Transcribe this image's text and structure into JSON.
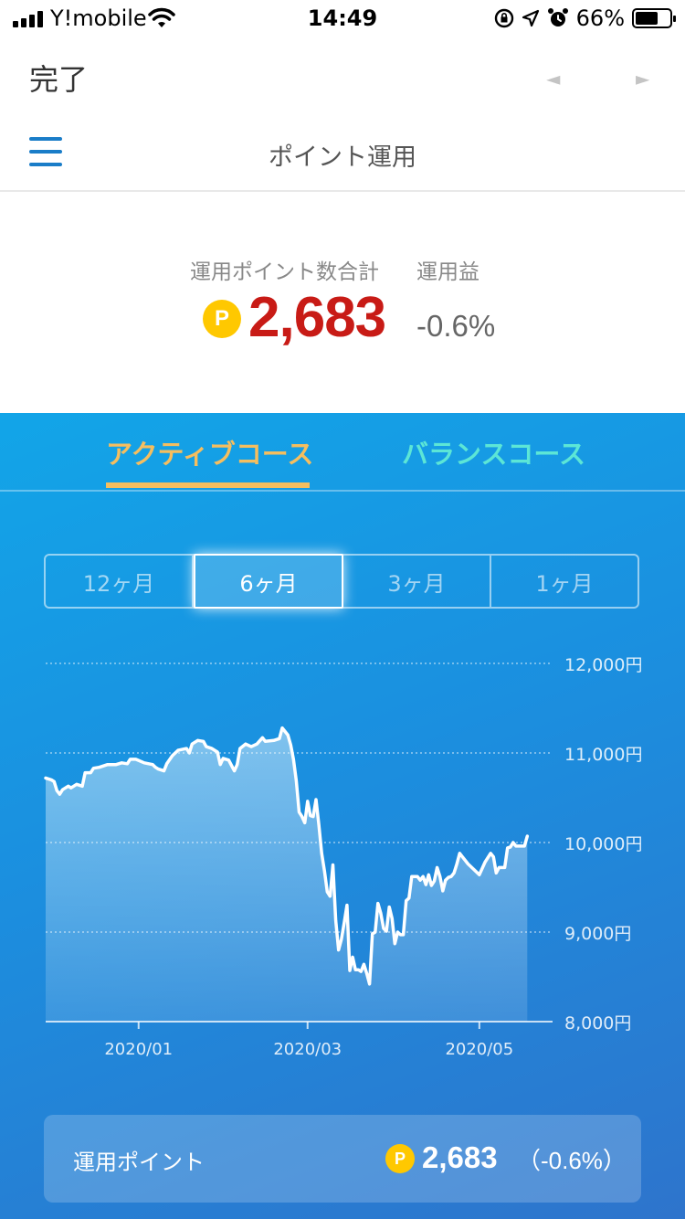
{
  "status_bar": {
    "carrier": "Y!mobile",
    "time": "14:49",
    "battery": "66%",
    "battery_level": 0.66
  },
  "nav": {
    "done_label": "完了",
    "prev_glyph": "◄",
    "next_glyph": "►",
    "title": "ポイント運用"
  },
  "summary": {
    "total_label": "運用ポイント数合計",
    "gain_label": "運用益",
    "coin_letter": "P",
    "total_value": "2,683",
    "gain_value": "-0.6%"
  },
  "tabs": [
    {
      "label": "アクティブコース",
      "active": true
    },
    {
      "label": "バランスコース",
      "active": false
    }
  ],
  "periods": [
    {
      "label": "12ヶ月",
      "active": false
    },
    {
      "label": "6ヶ月",
      "active": true
    },
    {
      "label": "3ヶ月",
      "active": false
    },
    {
      "label": "1ヶ月",
      "active": false
    }
  ],
  "chart_data": {
    "type": "area",
    "y_ticks": [
      "12,000円",
      "11,000円",
      "10,000円",
      "9,000円",
      "8,000円"
    ],
    "ylim": [
      8000,
      12000
    ],
    "x_ticks": [
      {
        "label": "2020/01",
        "day": 46
      },
      {
        "label": "2020/03",
        "day": 106
      },
      {
        "label": "2020/05",
        "day": 167
      }
    ],
    "x_range": [
      13,
      193
    ],
    "grid": true,
    "series": [
      {
        "values": [
          [
            13,
            10720
          ],
          [
            15,
            10700
          ],
          [
            16,
            10680
          ],
          [
            17,
            10580
          ],
          [
            18,
            10540
          ],
          [
            19,
            10590
          ],
          [
            21,
            10630
          ],
          [
            22,
            10610
          ],
          [
            24,
            10650
          ],
          [
            26,
            10630
          ],
          [
            27,
            10780
          ],
          [
            29,
            10780
          ],
          [
            30,
            10830
          ],
          [
            32,
            10840
          ],
          [
            35,
            10870
          ],
          [
            38,
            10870
          ],
          [
            40,
            10890
          ],
          [
            42,
            10880
          ],
          [
            43,
            10930
          ],
          [
            45,
            10930
          ],
          [
            48,
            10890
          ],
          [
            51,
            10870
          ],
          [
            52,
            10840
          ],
          [
            53,
            10820
          ],
          [
            55,
            10800
          ],
          [
            56,
            10880
          ],
          [
            58,
            10970
          ],
          [
            60,
            11030
          ],
          [
            63,
            11050
          ],
          [
            64,
            11000
          ],
          [
            65,
            11100
          ],
          [
            67,
            11140
          ],
          [
            69,
            11130
          ],
          [
            70,
            11070
          ],
          [
            72,
            11050
          ],
          [
            74,
            11010
          ],
          [
            75,
            10870
          ],
          [
            76,
            10940
          ],
          [
            78,
            10920
          ],
          [
            80,
            10800
          ],
          [
            81,
            10870
          ],
          [
            82,
            11050
          ],
          [
            84,
            11100
          ],
          [
            86,
            11070
          ],
          [
            88,
            11100
          ],
          [
            90,
            11170
          ],
          [
            91,
            11130
          ],
          [
            94,
            11140
          ],
          [
            96,
            11160
          ],
          [
            97,
            11280
          ],
          [
            99,
            11200
          ],
          [
            100,
            11090
          ],
          [
            101,
            10930
          ],
          [
            102,
            10690
          ],
          [
            103,
            10340
          ],
          [
            104,
            10290
          ],
          [
            105,
            10220
          ],
          [
            106,
            10460
          ],
          [
            107,
            10300
          ],
          [
            108,
            10290
          ],
          [
            109,
            10480
          ],
          [
            110,
            10200
          ],
          [
            111,
            9880
          ],
          [
            112,
            9680
          ],
          [
            113,
            9450
          ],
          [
            114,
            9400
          ],
          [
            115,
            9750
          ],
          [
            116,
            9130
          ],
          [
            117,
            8800
          ],
          [
            118,
            8920
          ],
          [
            119,
            9100
          ],
          [
            120,
            9300
          ],
          [
            121,
            8570
          ],
          [
            122,
            8720
          ],
          [
            123,
            8580
          ],
          [
            124,
            8580
          ],
          [
            125,
            8560
          ],
          [
            126,
            8640
          ],
          [
            127,
            8540
          ],
          [
            128,
            8420
          ],
          [
            129,
            8980
          ],
          [
            130,
            9000
          ],
          [
            131,
            9320
          ],
          [
            132,
            9210
          ],
          [
            133,
            9040
          ],
          [
            134,
            9010
          ],
          [
            135,
            9280
          ],
          [
            136,
            9150
          ],
          [
            137,
            8870
          ],
          [
            138,
            9000
          ],
          [
            139,
            8970
          ],
          [
            140,
            8970
          ],
          [
            141,
            9350
          ],
          [
            142,
            9380
          ],
          [
            143,
            9620
          ],
          [
            145,
            9620
          ],
          [
            146,
            9580
          ],
          [
            147,
            9620
          ],
          [
            148,
            9530
          ],
          [
            149,
            9640
          ],
          [
            150,
            9520
          ],
          [
            151,
            9570
          ],
          [
            152,
            9720
          ],
          [
            153,
            9620
          ],
          [
            154,
            9460
          ],
          [
            155,
            9580
          ],
          [
            156,
            9610
          ],
          [
            157,
            9620
          ],
          [
            158,
            9660
          ],
          [
            159,
            9760
          ],
          [
            160,
            9880
          ],
          [
            161,
            9840
          ],
          [
            163,
            9760
          ],
          [
            165,
            9700
          ],
          [
            167,
            9640
          ],
          [
            169,
            9780
          ],
          [
            171,
            9880
          ],
          [
            172,
            9840
          ],
          [
            173,
            9660
          ],
          [
            174,
            9720
          ],
          [
            176,
            9720
          ],
          [
            177,
            9940
          ],
          [
            178,
            9950
          ],
          [
            179,
            10000
          ],
          [
            180,
            9960
          ],
          [
            181,
            9960
          ],
          [
            183,
            9960
          ],
          [
            184,
            10070
          ]
        ]
      }
    ]
  },
  "footer": {
    "label": "運用ポイント",
    "value": "2,683",
    "change": "（-0.6%）"
  },
  "colors": {
    "accent_red": "#c81b16",
    "tab_active": "#f5be5f",
    "tab_inactive": "#5ce6d6",
    "menu_blue": "#1a7dc8",
    "coin_yellow": "#ffc800"
  }
}
